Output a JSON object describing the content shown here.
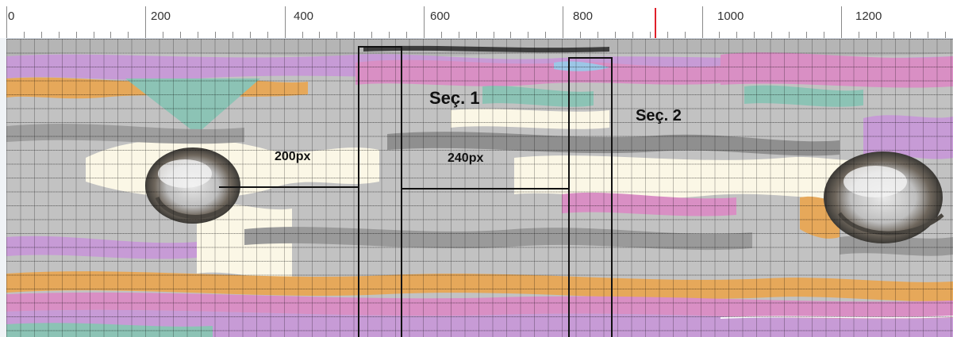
{
  "ruler": {
    "ticks": [
      "0",
      "200",
      "400",
      "600",
      "800",
      "1000",
      "1200"
    ],
    "marker_color": "#e0202a"
  },
  "canvas": {
    "sections": [
      {
        "label": "Seç. 1"
      },
      {
        "label": "Seç. 2"
      }
    ],
    "dimensions": [
      {
        "label": "200px"
      },
      {
        "label": "240px"
      }
    ]
  },
  "colors": {
    "lavender": "#c79bd6",
    "pink": "#d98fc4",
    "teal": "#8cc3b5",
    "cream": "#fbf7e6",
    "gray": "#b0b0b0",
    "orange": "#e6a85a",
    "blue": "#9cc6e6"
  }
}
